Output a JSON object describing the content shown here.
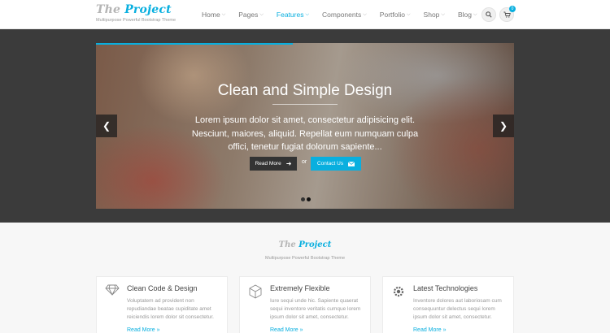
{
  "header": {
    "logo_prefix": "The ",
    "logo_accent": "Project",
    "tagline": "Multipurpose Powerful Bootstrap Theme",
    "nav": [
      {
        "label": "Home"
      },
      {
        "label": "Pages"
      },
      {
        "label": "Features"
      },
      {
        "label": "Components"
      },
      {
        "label": "Portfolio"
      },
      {
        "label": "Shop"
      },
      {
        "label": "Blog"
      }
    ],
    "active_nav": "Features",
    "cart_count": "0",
    "accent_color": "#09afdf"
  },
  "slider": {
    "title": "Clean and Simple Design",
    "text": "Lorem ipsum dolor sit amet, consectetur adipisicing elit. Nesciunt, maiores, aliquid. Repellat eum numquam culpa offici, tenetur fugiat dolorum sapiente...",
    "read_more": "Read More",
    "or": "or",
    "contact": "Contact Us",
    "prev_icon": "chevron-left-icon",
    "next_icon": "chevron-right-icon",
    "slide_count": 2,
    "active_slide": 2
  },
  "intro": {
    "logo_prefix": "The ",
    "logo_accent": "Project",
    "tagline": "Multipurpose Powerful Bootstrap Theme"
  },
  "features": [
    {
      "icon": "diamond-icon",
      "title": "Clean Code & Design",
      "text": "Voluptatem ad provident non repudiandae beatae cupiditate amet reiciendis lorem dolor sit consectetur.",
      "link": "Read More"
    },
    {
      "icon": "hexagon-cube-icon",
      "title": "Extremely Flexible",
      "text": "Iure sequi unde hic. Sapiente quaerat sequi inventore veritatis cumque lorem ipsum dolor sit amet, consectetur.",
      "link": "Read More"
    },
    {
      "icon": "gear-icon",
      "title": "Latest Technologies",
      "text": "Inventore dolores aut laboriosam cum consequuntur delectus sequi lorem ipsum dolor sit amet, consectetur.",
      "link": "Read More"
    }
  ]
}
